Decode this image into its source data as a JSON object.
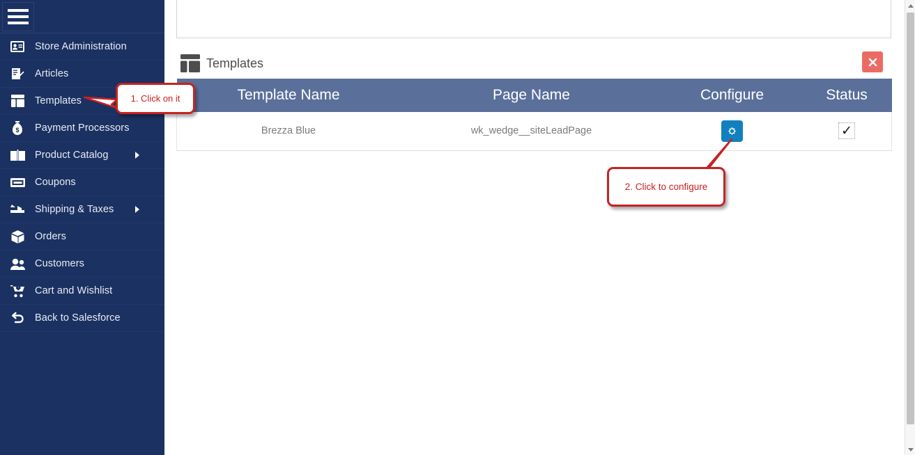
{
  "sidebar": {
    "menu_toggle": "menu-toggle",
    "items": [
      {
        "label": "Store Administration",
        "icon": "id-card-icon",
        "has_submenu": false
      },
      {
        "label": "Articles",
        "icon": "article-edit-icon",
        "has_submenu": false
      },
      {
        "label": "Templates",
        "icon": "layout-icon",
        "has_submenu": false
      },
      {
        "label": "Payment Processors",
        "icon": "money-bag-icon",
        "has_submenu": false
      },
      {
        "label": "Product Catalog",
        "icon": "book-icon",
        "has_submenu": true
      },
      {
        "label": "Coupons",
        "icon": "ticket-icon",
        "has_submenu": false
      },
      {
        "label": "Shipping & Taxes",
        "icon": "truck-icon",
        "has_submenu": true
      },
      {
        "label": "Orders",
        "icon": "box-icon",
        "has_submenu": false
      },
      {
        "label": "Customers",
        "icon": "users-icon",
        "has_submenu": false
      },
      {
        "label": "Cart and Wishlist",
        "icon": "cart-heart-icon",
        "has_submenu": false
      },
      {
        "label": "Back to Salesforce",
        "icon": "undo-arrow-icon",
        "has_submenu": false
      }
    ]
  },
  "panel": {
    "title": "Templates",
    "icon": "layout-icon",
    "close_icon": "close-icon"
  },
  "table": {
    "columns": [
      "Template Name",
      "Page Name",
      "Configure",
      "Status"
    ],
    "rows": [
      {
        "template_name": "Brezza Blue",
        "page_name": "wk_wedge__siteLeadPage",
        "configure_icon": "gear-icon",
        "status": "✓"
      }
    ]
  },
  "callouts": [
    {
      "text": "1. Click on it"
    },
    {
      "text": "2. Click to configure"
    }
  ],
  "colors": {
    "sidebar_bg": "#1b3161",
    "table_header_bg": "#5a6f9a",
    "gear_button_bg": "#1280bf",
    "close_button_bg": "#eb6b63",
    "callout_border": "#c62222",
    "callout_text": "#cc2020"
  },
  "scrollbar": {
    "up_icon": "chevron-up-icon",
    "down_icon": "chevron-down-icon"
  }
}
